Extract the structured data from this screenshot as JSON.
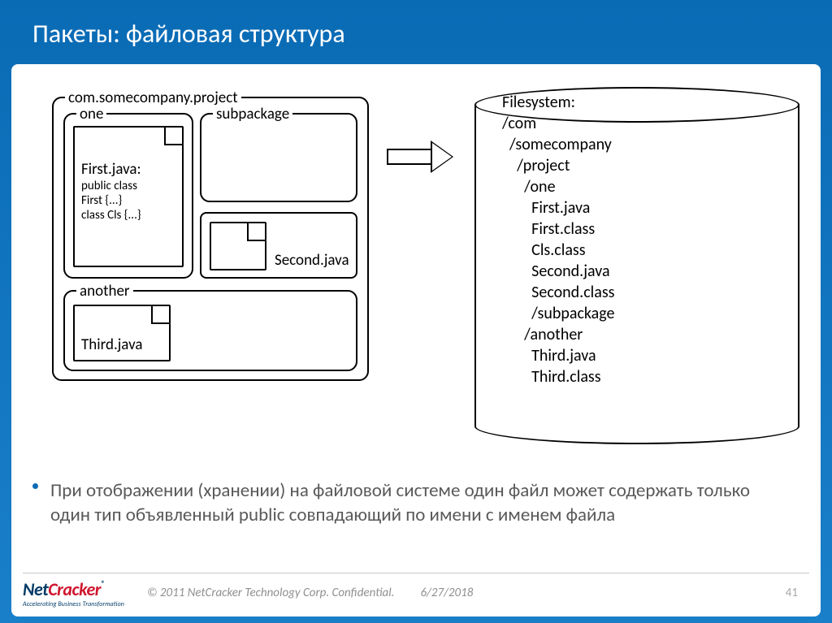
{
  "title": "Пакеты: файловая структура",
  "packages": {
    "outerLabel": "com.somecompany.project",
    "oneLabel": "one",
    "subLabel": "subpackage",
    "anotherLabel": "another",
    "firstFile": {
      "title": "First.java:",
      "line1": "public class",
      "line2": "First {...}",
      "line3": "class Cls {...}"
    },
    "secondFile": "Second.java",
    "thirdFile": "Third.java"
  },
  "filesystem": {
    "lines": "Filesystem:\n/com\n  /somecompany\n    /project\n      /one\n        First.java\n        First.class\n        Cls.class\n        Second.java\n        Second.class\n        /subpackage\n      /another\n        Third.java\n        Third.class"
  },
  "bullet": "При отображении (хранении) на файловой системе один файл может содержать только один тип объявленный public совпадающий по имени с именем файла",
  "footer": {
    "logoNet": "Net",
    "logoCracker": "Cracker",
    "logoReg": "®",
    "logoTag": "Accelerating Business Transformation",
    "copyright": "© 2011 NetCracker Technology Corp. Confidential.",
    "date": "6/27/2018",
    "page": "41"
  }
}
